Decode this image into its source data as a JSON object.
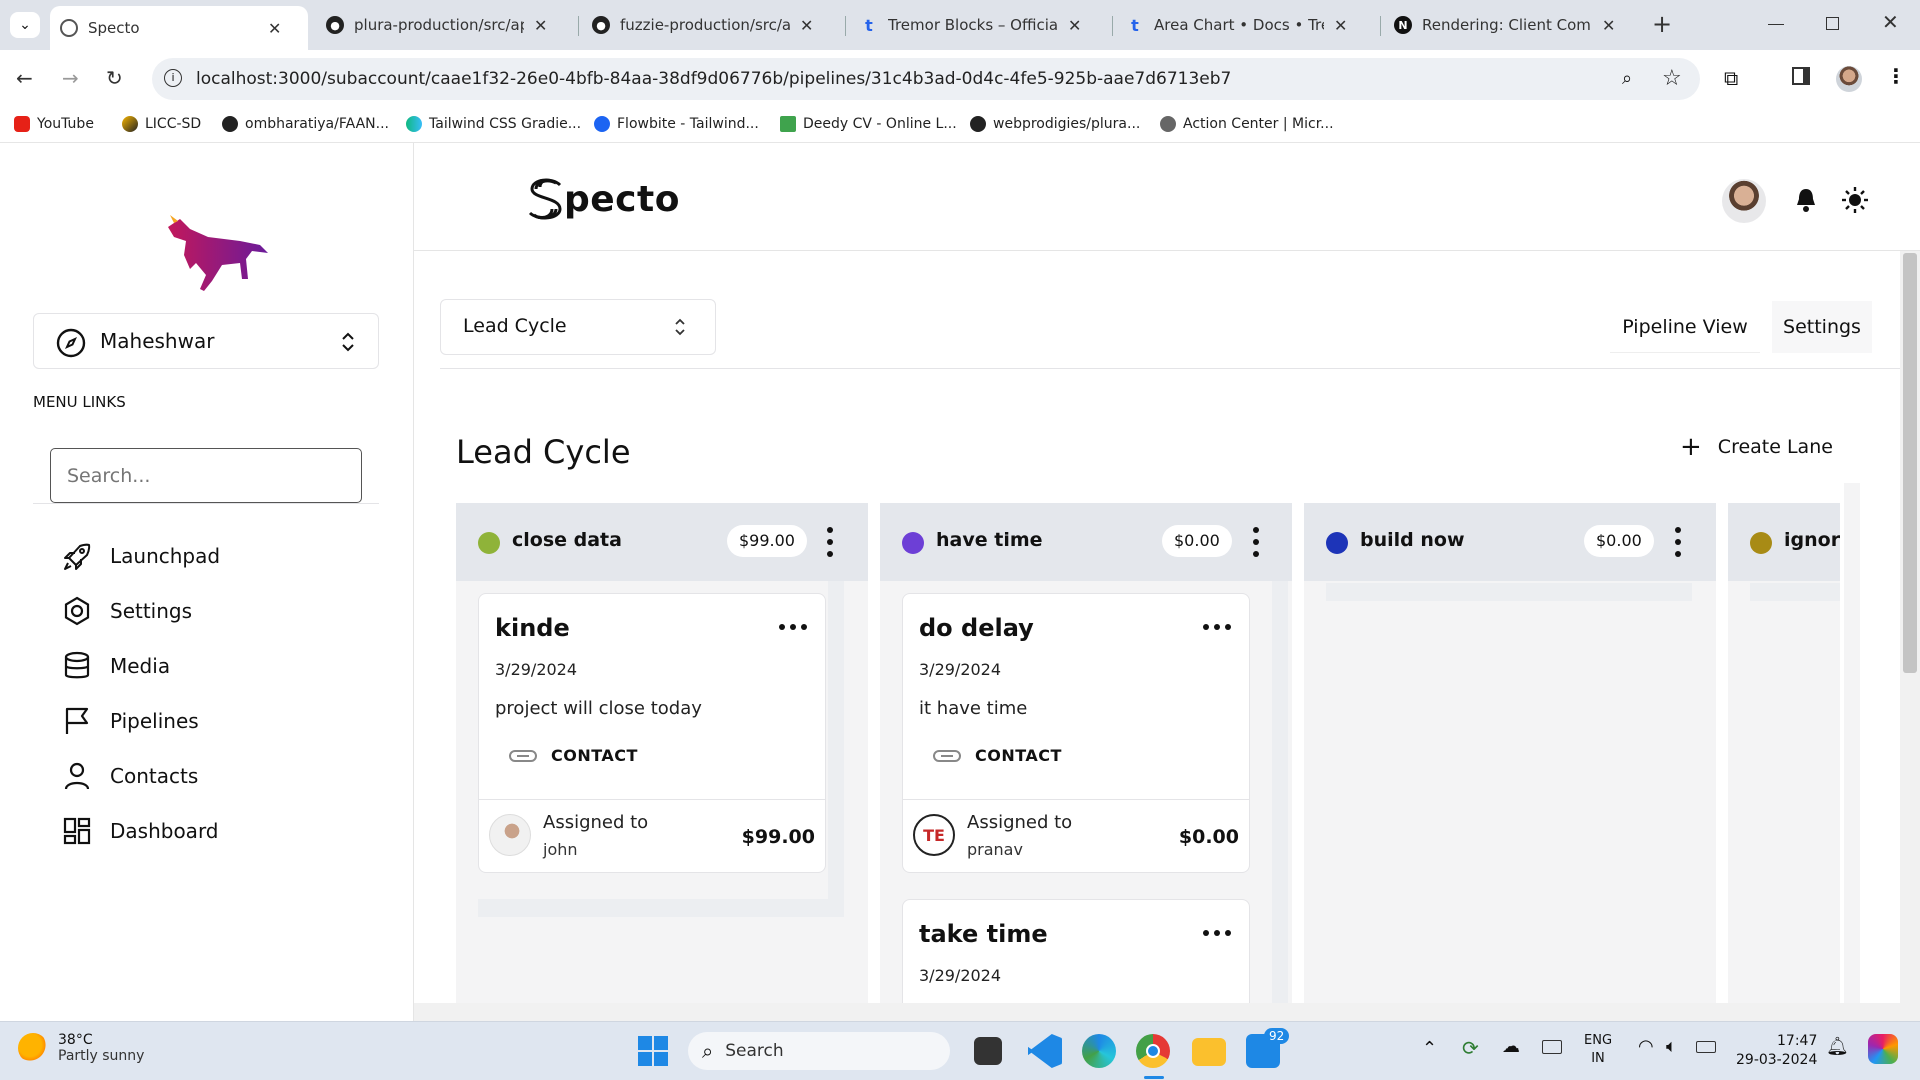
{
  "browser": {
    "tabs": [
      {
        "label": "Specto",
        "active": true
      },
      {
        "label": "plura-production/src/app/("
      },
      {
        "label": "fuzzie-production/src/app/"
      },
      {
        "label": "Tremor Blocks – Official Tre"
      },
      {
        "label": "Area Chart • Docs • Tremor"
      },
      {
        "label": "Rendering: Client Compon"
      }
    ],
    "url": "localhost:3000/subaccount/caae1f32-26e0-4bfb-84aa-38df9d06776b/pipelines/31c4b3ad-0d4c-4fe5-925b-aae7d6713eb7",
    "bookmarks": [
      "YouTube",
      "LICC-SD",
      "ombharatiya/FAAN...",
      "Tailwind CSS Gradie...",
      "Flowbite - Tailwind...",
      "Deedy CV - Online L...",
      "webprodigies/plura...",
      "Action Center | Micr..."
    ]
  },
  "header": {
    "logo_text": "pecto"
  },
  "sidebar": {
    "account_name": "Maheshwar",
    "menu_links_label": "MENU LINKS",
    "search_placeholder": "Search...",
    "items": [
      {
        "label": "Launchpad",
        "icon": "rocket-icon"
      },
      {
        "label": "Settings",
        "icon": "gear-icon"
      },
      {
        "label": "Media",
        "icon": "database-icon"
      },
      {
        "label": "Pipelines",
        "icon": "flag-icon"
      },
      {
        "label": "Contacts",
        "icon": "user-icon"
      },
      {
        "label": "Dashboard",
        "icon": "dashboard-icon"
      }
    ]
  },
  "pipeline": {
    "selector_label": "Lead Cycle",
    "tabs": [
      "Pipeline View",
      "Settings"
    ],
    "title": "Lead Cycle",
    "create_lane_label": "Create Lane",
    "lanes": [
      {
        "name": "close data",
        "amount": "$99.00",
        "color": "#8fb339"
      },
      {
        "name": "have time",
        "amount": "$0.00",
        "color": "#6d3fd6"
      },
      {
        "name": "build now",
        "amount": "$0.00",
        "color": "#1d34b8"
      },
      {
        "name": "ignore",
        "amount": "",
        "color": "#a88b15"
      }
    ],
    "cards": [
      {
        "title": "kinde",
        "date": "3/29/2024",
        "description": "project will close today",
        "link_label": "CONTACT",
        "assigned_label": "Assigned to",
        "assignee": "john",
        "amount": "$99.00"
      },
      {
        "title": "do delay",
        "date": "3/29/2024",
        "description": "it have time",
        "link_label": "CONTACT",
        "assigned_label": "Assigned to",
        "assignee": "pranav",
        "amount": "$0.00"
      },
      {
        "title": "take time",
        "date": "3/29/2024"
      }
    ]
  },
  "taskbar": {
    "weather_temp": "38°C",
    "weather_desc": "Partly sunny",
    "search_label": "Search",
    "badge_count": "92",
    "lang": "ENG",
    "region": "IN",
    "time": "17:47",
    "date": "29-03-2024"
  },
  "colors": {
    "accent": "#111111",
    "lane_header": "#e4e7ec"
  }
}
